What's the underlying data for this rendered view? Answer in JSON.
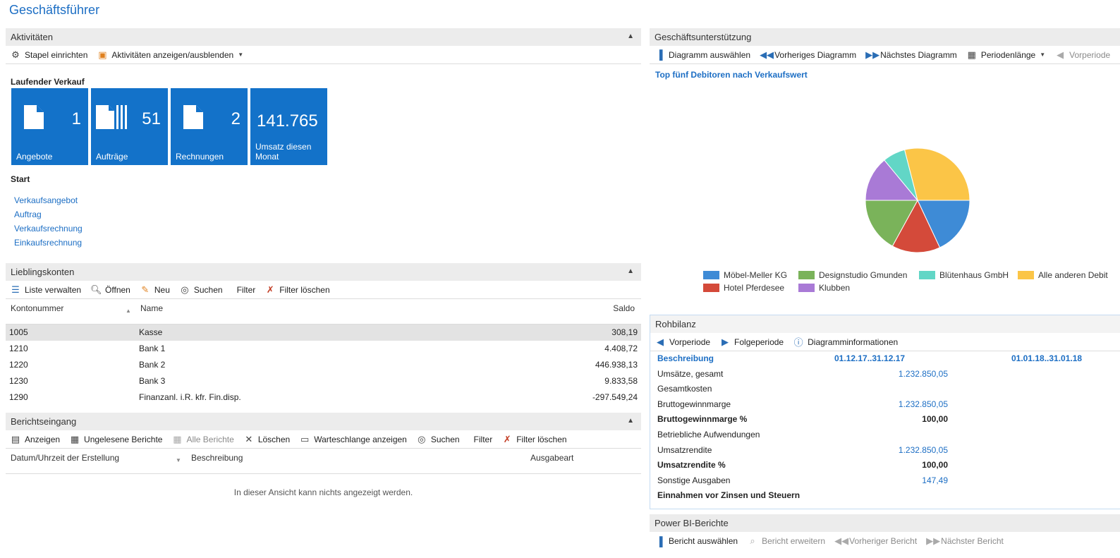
{
  "page": {
    "title": "Geschäftsführer"
  },
  "aktivitaeten": {
    "title": "Aktivitäten",
    "toolbar": {
      "stapel": "Stapel einrichten",
      "anzeigen": "Aktivitäten anzeigen/ausblenden"
    },
    "group_label": "Laufender Verkauf",
    "tiles": [
      {
        "value": "1",
        "label": "Angebote"
      },
      {
        "value": "51",
        "label": "Aufträge"
      },
      {
        "value": "2",
        "label": "Rechnungen"
      },
      {
        "value": "141.765",
        "label_line1": "Umsatz diesen",
        "label_line2": "Monat"
      }
    ],
    "start_label": "Start",
    "links": [
      "Verkaufsangebot",
      "Auftrag",
      "Verkaufsrechnung",
      "Einkaufsrechnung"
    ]
  },
  "lieblingskonten": {
    "title": "Lieblingskonten",
    "toolbar": {
      "liste": "Liste verwalten",
      "oeffnen": "Öffnen",
      "neu": "Neu",
      "suchen": "Suchen",
      "filter": "Filter",
      "filter_loeschen": "Filter löschen"
    },
    "columns": {
      "nr": "Kontonummer",
      "name": "Name",
      "saldo": "Saldo"
    },
    "rows": [
      {
        "nr": "1005",
        "name": "Kasse",
        "saldo": "308,19"
      },
      {
        "nr": "1210",
        "name": "Bank 1",
        "saldo": "4.408,72"
      },
      {
        "nr": "1220",
        "name": "Bank 2",
        "saldo": "446.938,13"
      },
      {
        "nr": "1230",
        "name": "Bank 3",
        "saldo": "9.833,58"
      },
      {
        "nr": "1290",
        "name": "Finanzanl. i.R. kfr. Fin.disp.",
        "saldo": "-297.549,24"
      }
    ]
  },
  "berichtseingang": {
    "title": "Berichtseingang",
    "toolbar": {
      "anzeigen": "Anzeigen",
      "ungelesen": "Ungelesene Berichte",
      "alle": "Alle Berichte",
      "loeschen": "Löschen",
      "warteschlange": "Warteschlange anzeigen",
      "suchen": "Suchen",
      "filter": "Filter",
      "filter_loeschen": "Filter löschen"
    },
    "columns": {
      "datum": "Datum/Uhrzeit der Erstellung",
      "beschreibung": "Beschreibung",
      "ausgabeart": "Ausgabeart"
    },
    "empty": "In dieser Ansicht kann nichts angezeigt werden."
  },
  "geschaeftsunterstuetzung": {
    "title": "Geschäftsunterstützung",
    "toolbar": {
      "diagramm": "Diagramm auswählen",
      "vorheriges": "Vorheriges Diagramm",
      "naechstes": "Nächstes Diagramm",
      "periodenlaenge": "Periodenlänge",
      "vorperiode": "Vorperiode"
    }
  },
  "chart_data": {
    "type": "pie",
    "title": "Top fünf Debitoren nach Verkaufswert",
    "categories": [
      "Möbel-Meller KG",
      "Hotel Pferdesee",
      "Designstudio Gmunden",
      "Klubben",
      "Blütenhaus GmbH",
      "Alle anderen Debit"
    ],
    "values": [
      18,
      15,
      17,
      14,
      7,
      29
    ],
    "colors": [
      "#3e8bd6",
      "#d44a3a",
      "#7ab35a",
      "#a97ad6",
      "#62d6c6",
      "#fbc547"
    ],
    "legend": "bottom"
  },
  "rohbilanz": {
    "title": "Rohbilanz",
    "toolbar": {
      "vorperiode": "Vorperiode",
      "folgeperiode": "Folgeperiode",
      "info": "Diagramminformationen"
    },
    "header": {
      "beschreibung": "Beschreibung",
      "p1": "01.12.17..31.12.17",
      "p2": "01.01.18..31.01.18"
    },
    "rows": [
      {
        "label": "Umsätze, gesamt",
        "value": "1.232.850,05",
        "bold": false
      },
      {
        "label": "Gesamtkosten",
        "value": "",
        "bold": false
      },
      {
        "label": "Bruttogewinnmarge",
        "value": "1.232.850,05",
        "bold": false
      },
      {
        "label": "Bruttogewinnmarge %",
        "value": "100,00",
        "bold": true
      },
      {
        "label": "Betriebliche Aufwendungen",
        "value": "",
        "bold": false
      },
      {
        "label": "Umsatzrendite",
        "value": "1.232.850,05",
        "bold": false
      },
      {
        "label": "Umsatzrendite %",
        "value": "100,00",
        "bold": true
      },
      {
        "label": "Sonstige Ausgaben",
        "value": "147,49",
        "bold": false
      },
      {
        "label": "Einnahmen vor Zinsen und Steuern",
        "value": "",
        "bold": true
      }
    ]
  },
  "powerbi": {
    "title": "Power BI-Berichte",
    "toolbar": {
      "auswaehlen": "Bericht auswählen",
      "erweitern": "Bericht erweitern",
      "vorheriger": "Vorheriger Bericht",
      "naechster": "Nächster Bericht"
    }
  }
}
